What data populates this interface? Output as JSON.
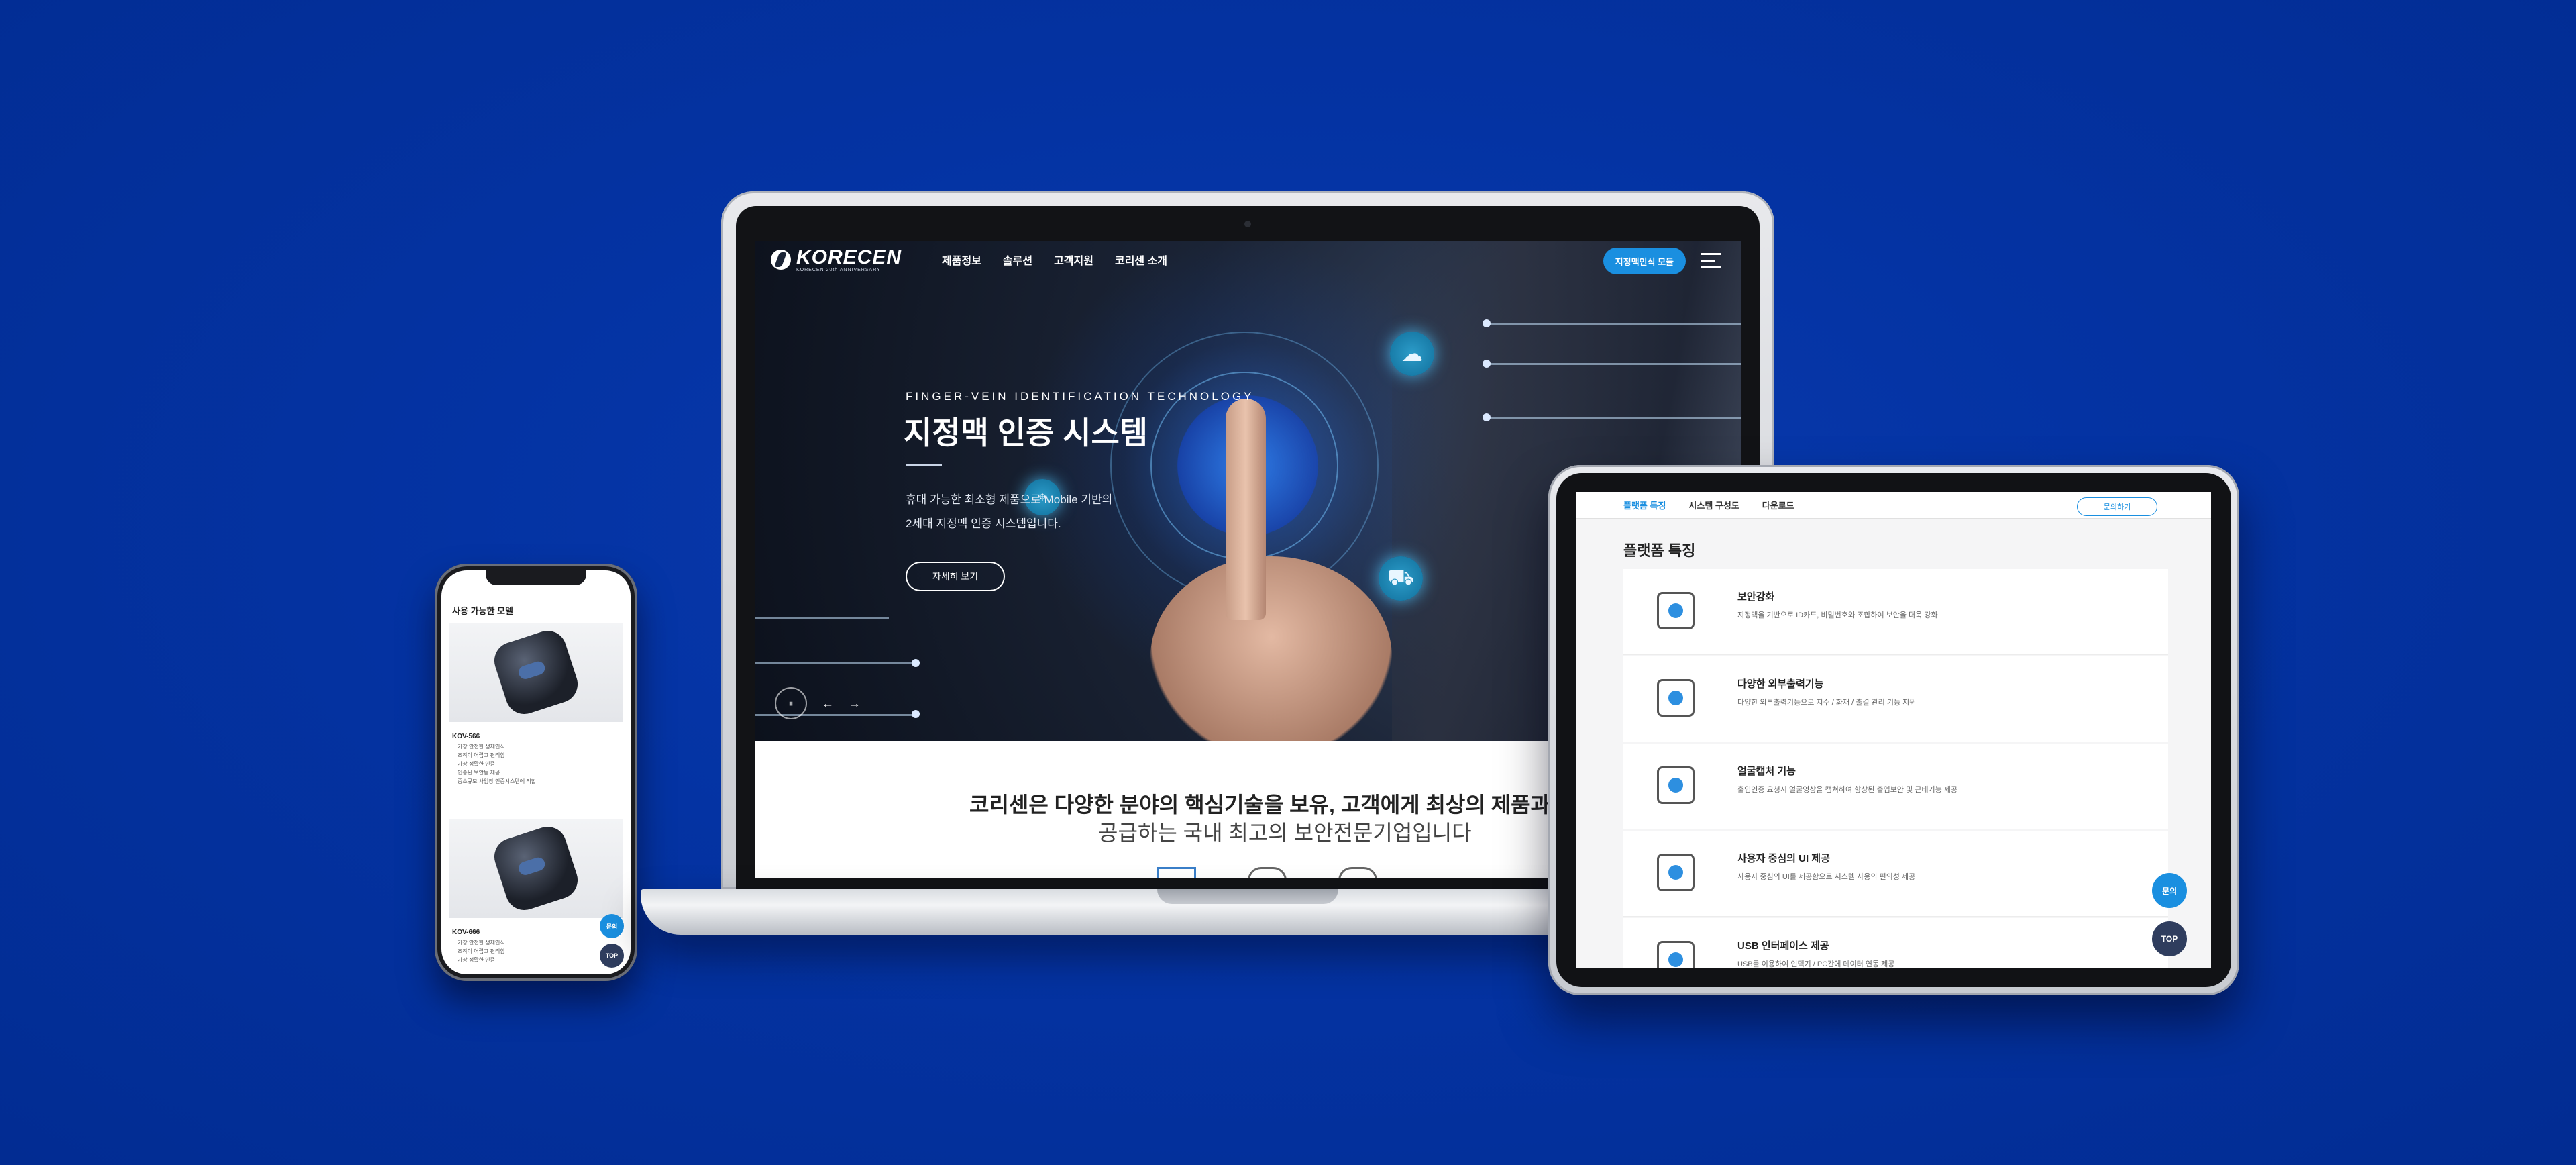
{
  "laptop": {
    "nav": {
      "logo": "KORECEN",
      "logo_sub": "KORECEN 20th ANNIVERSARY",
      "menu": [
        "제품정보",
        "솔루션",
        "고객지원",
        "코리센 소개"
      ],
      "cta": "지정맥인식 모듈"
    },
    "hero": {
      "eyebrow": "FINGER-VEIN IDENTIFICATION TECHNOLOGY",
      "title": "지정맥 인증 시스템",
      "desc_line1": "휴대 가능한 최소형 제품으로 Mobile 기반의",
      "desc_line2": "2세대 지정맥 인증 시스템입니다.",
      "button": "자세히 보기",
      "ctrl_pause": "⏸",
      "ctrl_prev": "←",
      "ctrl_next": "→"
    },
    "intro": {
      "line1": "코리센은 다양한 분야의 핵심기술을 보유, 고객에게 최상의 제품과 솔루션을",
      "line2": "공급하는 국내 최고의 보안전문기업입니다"
    }
  },
  "phone": {
    "heading": "사용 가능한 모델",
    "models": [
      {
        "name": "KOV-566",
        "features": [
          "가장 안전한 생체인식",
          "조작이 어렵고 편리함",
          "가장 정확한 인증",
          "인증된 보안등 제공",
          "중소규모 사업장 인증시스템에 적합"
        ]
      },
      {
        "name": "KOV-666",
        "features": [
          "가장 안전한 생체인식",
          "조작이 어렵고 편리함",
          "가장 정확한 인증"
        ]
      }
    ],
    "fab_inquiry": "문의",
    "fab_top": "TOP"
  },
  "tablet": {
    "tabs": [
      {
        "label": "플랫폼 특징",
        "active": true
      },
      {
        "label": "시스템 구성도",
        "active": false
      },
      {
        "label": "다운로드",
        "active": false
      }
    ],
    "inquiry": "문의하기",
    "title": "플랫폼 특징",
    "features": [
      {
        "icon": "touch-icon",
        "title": "보안강화",
        "desc": "지정맥을 기반으로 ID카드, 비밀번호와 조합하여 보안을 더욱 강화"
      },
      {
        "icon": "monitor-icon",
        "title": "다양한 외부출력기능",
        "desc": "다양한 외부출력기능으로 지수 / 화재 / 출결 관리 기능 지원"
      },
      {
        "icon": "face-capture-icon",
        "title": "얼굴캡처 기능",
        "desc": "출입인증 요청시 얼굴영상을 캡쳐하여 향상된 출입보안 및 근태기능 제공"
      },
      {
        "icon": "user-ui-icon",
        "title": "사용자 중심의 UI 제공",
        "desc": "사용자 중심의 UI를 제공함으로 시스템 사용의 편의성 제공"
      },
      {
        "icon": "usb-icon",
        "title": "USB 인터페이스 제공",
        "desc": "USB를 이용하여 인덱기 / PC간에 데이터 연동 제공"
      }
    ],
    "fab_inquiry": "문의",
    "fab_top": "TOP"
  }
}
